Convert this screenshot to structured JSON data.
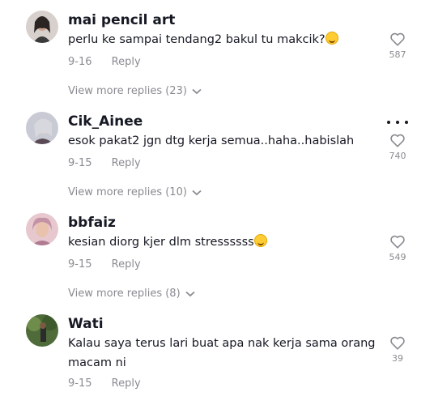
{
  "comments": [
    {
      "username": "mai pencil art",
      "text": "perlu ke sampai tendang2 bakul tu makcik?",
      "emoji": "grinning-sweat-emoji",
      "date": "9-16",
      "reply_label": "Reply",
      "likes": "587",
      "more_replies": "View more replies (23)"
    },
    {
      "username": "Cik_Ainee",
      "text": "esok pakat2 jgn dtg kerja semua..haha..habislah",
      "date": "9-15",
      "reply_label": "Reply",
      "likes": "740",
      "more_replies": "View more replies (10)"
    },
    {
      "username": "bbfaiz",
      "text": "kesian diorg kjer dlm stressssss",
      "emoji": "tears-of-joy-emoji",
      "date": "9-15",
      "reply_label": "Reply",
      "likes": "549",
      "more_replies": "View more replies (8)"
    },
    {
      "username": "Wati",
      "text": "Kalau saya terus lari buat apa nak kerja sama orang macam ni",
      "date": "9-15",
      "reply_label": "Reply",
      "likes": "39"
    }
  ],
  "icons": {
    "like": "heart-outline-icon",
    "more": "chevron-down-icon",
    "options": "more-horizontal-icon"
  },
  "colors": {
    "text": "#161823",
    "muted": "#8a8b91",
    "emoji": "#ffcc33"
  }
}
